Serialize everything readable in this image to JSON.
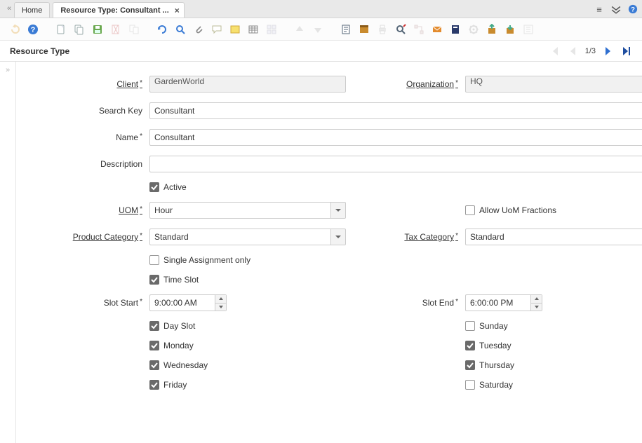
{
  "tabs": {
    "home": "Home",
    "active": "Resource Type: Consultant ..."
  },
  "header": {
    "title": "Resource Type",
    "nav_count": "1/3"
  },
  "toolbar_icons": [
    "undo",
    "help",
    "new",
    "copy",
    "save",
    "delete",
    "ignore",
    "refresh",
    "find",
    "attach",
    "chat",
    "note",
    "grid",
    "multi",
    "up",
    "down",
    "report",
    "archive",
    "print",
    "zoom",
    "workflow",
    "process",
    "product",
    "tools",
    "export",
    "import",
    "customize"
  ],
  "form": {
    "labels": {
      "client": "Client",
      "organization": "Organization",
      "search_key": "Search Key",
      "name": "Name",
      "description": "Description",
      "active": "Active",
      "uom": "UOM",
      "allow_fractions": "Allow UoM Fractions",
      "product_category": "Product Category",
      "tax_category": "Tax Category",
      "single_assignment": "Single Assignment only",
      "time_slot": "Time Slot",
      "slot_start": "Slot Start",
      "slot_end": "Slot End",
      "day_slot": "Day Slot",
      "sunday": "Sunday",
      "monday": "Monday",
      "tuesday": "Tuesday",
      "wednesday": "Wednesday",
      "thursday": "Thursday",
      "friday": "Friday",
      "saturday": "Saturday"
    },
    "values": {
      "client": "GardenWorld",
      "organization": "HQ",
      "search_key": "Consultant",
      "name": "Consultant",
      "description": "",
      "uom": "Hour",
      "product_category": "Standard",
      "tax_category": "Standard",
      "slot_start": "9:00:00 AM",
      "slot_end": "6:00:00 PM"
    },
    "checks": {
      "active": true,
      "allow_fractions": false,
      "single_assignment": false,
      "time_slot": true,
      "day_slot": true,
      "sunday": false,
      "monday": true,
      "tuesday": true,
      "wednesday": true,
      "thursday": true,
      "friday": true,
      "saturday": false
    }
  }
}
